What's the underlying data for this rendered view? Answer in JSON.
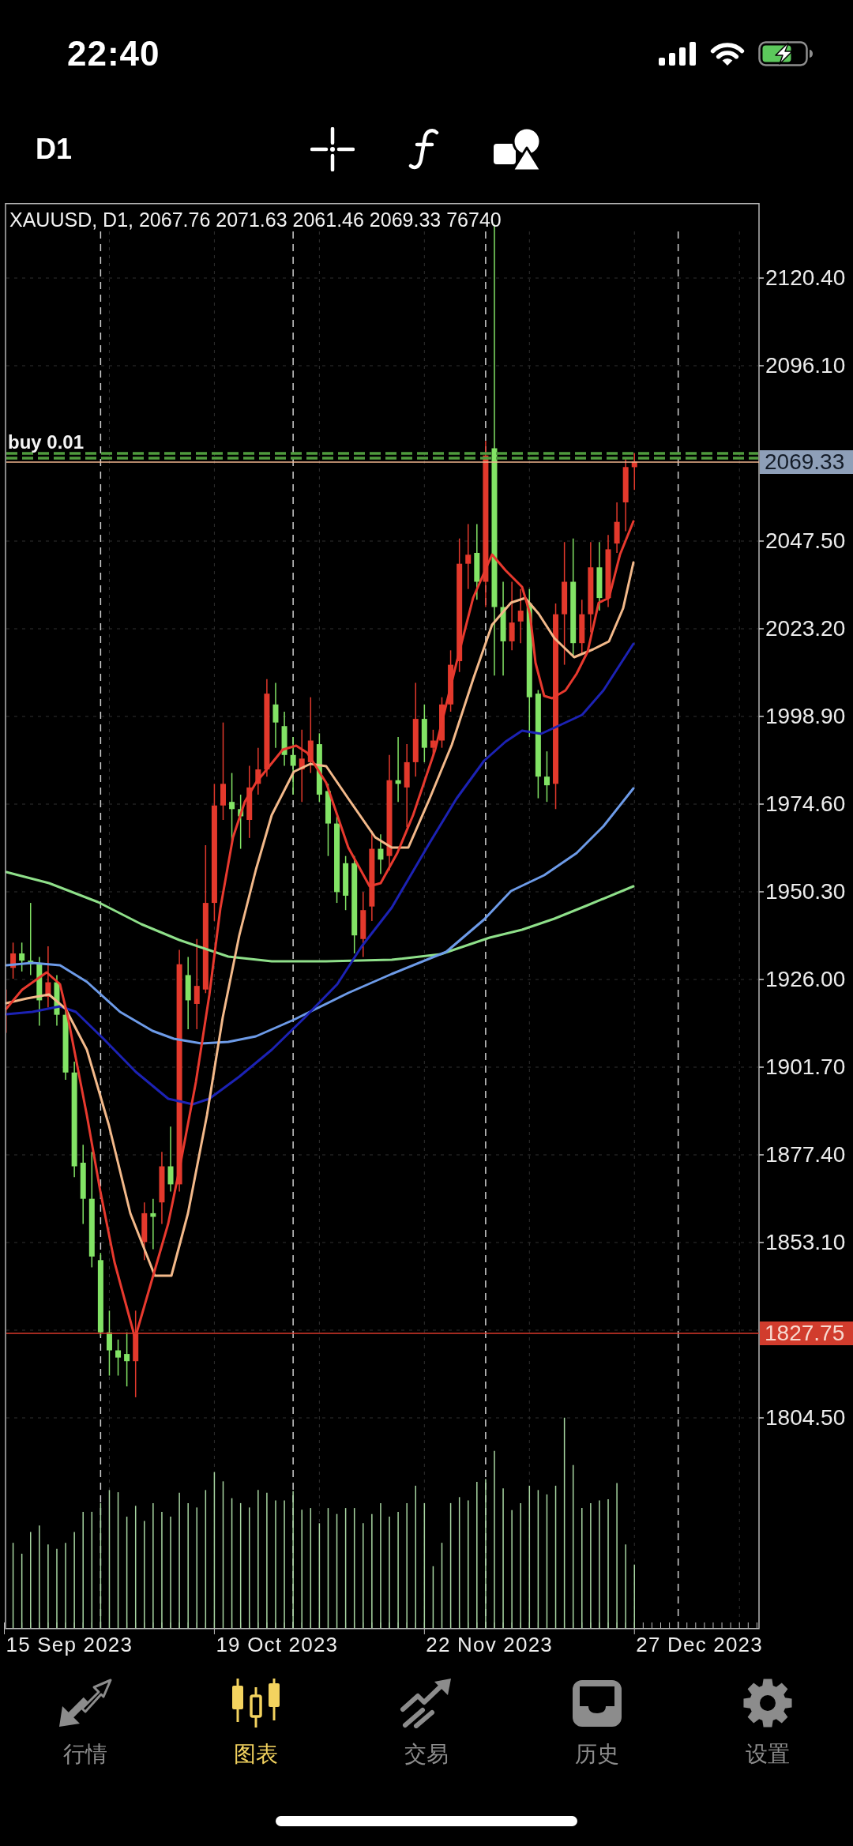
{
  "status_bar": {
    "time": "22:40"
  },
  "toolbar": {
    "timeframe": "D1"
  },
  "chart": {
    "symbol_info": "XAUUSD, D1, 2067.76 2071.63 2061.46 2069.33 76740",
    "order_label": "buy 0.01",
    "price_axis": [
      {
        "kind": "tick",
        "text": "2120.40"
      },
      {
        "kind": "tick",
        "text": "2096.10"
      },
      {
        "kind": "bid",
        "text": "2069.33"
      },
      {
        "kind": "tick",
        "text": "2047.50"
      },
      {
        "kind": "tick",
        "text": "2023.20"
      },
      {
        "kind": "tick",
        "text": "1998.90"
      },
      {
        "kind": "tick",
        "text": "1974.60"
      },
      {
        "kind": "tick",
        "text": "1950.30"
      },
      {
        "kind": "tick",
        "text": "1926.00"
      },
      {
        "kind": "tick",
        "text": "1901.70"
      },
      {
        "kind": "tick",
        "text": "1877.40"
      },
      {
        "kind": "tick",
        "text": "1853.10"
      },
      {
        "kind": "alert",
        "text": "1827.75"
      },
      {
        "kind": "tick",
        "text": "1804.50"
      }
    ],
    "time_axis": [
      "15 Sep 2023",
      "19 Oct 2023",
      "22 Nov 2023",
      "27 Dec 2023"
    ]
  },
  "tabs": [
    {
      "label": "行情",
      "selected": false
    },
    {
      "label": "图表",
      "selected": true
    },
    {
      "label": "交易",
      "selected": false
    },
    {
      "label": "历史",
      "selected": false
    },
    {
      "label": "设置",
      "selected": false
    }
  ]
}
